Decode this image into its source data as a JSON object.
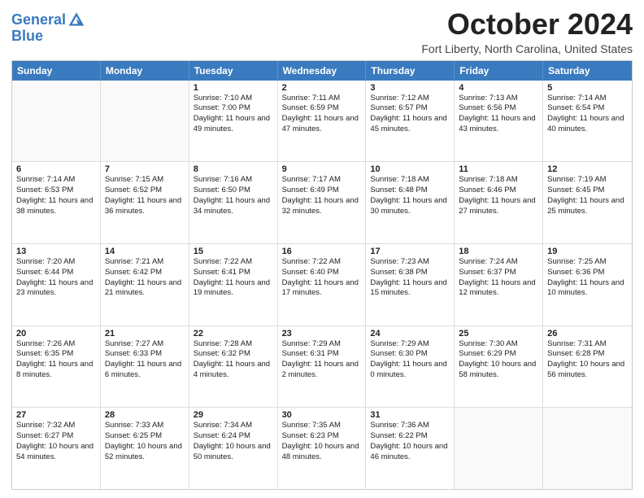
{
  "header": {
    "logo_line1": "General",
    "logo_line2": "Blue",
    "month_title": "October 2024",
    "location": "Fort Liberty, North Carolina, United States"
  },
  "weekdays": [
    "Sunday",
    "Monday",
    "Tuesday",
    "Wednesday",
    "Thursday",
    "Friday",
    "Saturday"
  ],
  "rows": [
    [
      {
        "day": "",
        "sunrise": "",
        "sunset": "",
        "daylight": "",
        "empty": true
      },
      {
        "day": "",
        "sunrise": "",
        "sunset": "",
        "daylight": "",
        "empty": true
      },
      {
        "day": "1",
        "sunrise": "Sunrise: 7:10 AM",
        "sunset": "Sunset: 7:00 PM",
        "daylight": "Daylight: 11 hours and 49 minutes."
      },
      {
        "day": "2",
        "sunrise": "Sunrise: 7:11 AM",
        "sunset": "Sunset: 6:59 PM",
        "daylight": "Daylight: 11 hours and 47 minutes."
      },
      {
        "day": "3",
        "sunrise": "Sunrise: 7:12 AM",
        "sunset": "Sunset: 6:57 PM",
        "daylight": "Daylight: 11 hours and 45 minutes."
      },
      {
        "day": "4",
        "sunrise": "Sunrise: 7:13 AM",
        "sunset": "Sunset: 6:56 PM",
        "daylight": "Daylight: 11 hours and 43 minutes."
      },
      {
        "day": "5",
        "sunrise": "Sunrise: 7:14 AM",
        "sunset": "Sunset: 6:54 PM",
        "daylight": "Daylight: 11 hours and 40 minutes."
      }
    ],
    [
      {
        "day": "6",
        "sunrise": "Sunrise: 7:14 AM",
        "sunset": "Sunset: 6:53 PM",
        "daylight": "Daylight: 11 hours and 38 minutes."
      },
      {
        "day": "7",
        "sunrise": "Sunrise: 7:15 AM",
        "sunset": "Sunset: 6:52 PM",
        "daylight": "Daylight: 11 hours and 36 minutes."
      },
      {
        "day": "8",
        "sunrise": "Sunrise: 7:16 AM",
        "sunset": "Sunset: 6:50 PM",
        "daylight": "Daylight: 11 hours and 34 minutes."
      },
      {
        "day": "9",
        "sunrise": "Sunrise: 7:17 AM",
        "sunset": "Sunset: 6:49 PM",
        "daylight": "Daylight: 11 hours and 32 minutes."
      },
      {
        "day": "10",
        "sunrise": "Sunrise: 7:18 AM",
        "sunset": "Sunset: 6:48 PM",
        "daylight": "Daylight: 11 hours and 30 minutes."
      },
      {
        "day": "11",
        "sunrise": "Sunrise: 7:18 AM",
        "sunset": "Sunset: 6:46 PM",
        "daylight": "Daylight: 11 hours and 27 minutes."
      },
      {
        "day": "12",
        "sunrise": "Sunrise: 7:19 AM",
        "sunset": "Sunset: 6:45 PM",
        "daylight": "Daylight: 11 hours and 25 minutes."
      }
    ],
    [
      {
        "day": "13",
        "sunrise": "Sunrise: 7:20 AM",
        "sunset": "Sunset: 6:44 PM",
        "daylight": "Daylight: 11 hours and 23 minutes."
      },
      {
        "day": "14",
        "sunrise": "Sunrise: 7:21 AM",
        "sunset": "Sunset: 6:42 PM",
        "daylight": "Daylight: 11 hours and 21 minutes."
      },
      {
        "day": "15",
        "sunrise": "Sunrise: 7:22 AM",
        "sunset": "Sunset: 6:41 PM",
        "daylight": "Daylight: 11 hours and 19 minutes."
      },
      {
        "day": "16",
        "sunrise": "Sunrise: 7:22 AM",
        "sunset": "Sunset: 6:40 PM",
        "daylight": "Daylight: 11 hours and 17 minutes."
      },
      {
        "day": "17",
        "sunrise": "Sunrise: 7:23 AM",
        "sunset": "Sunset: 6:38 PM",
        "daylight": "Daylight: 11 hours and 15 minutes."
      },
      {
        "day": "18",
        "sunrise": "Sunrise: 7:24 AM",
        "sunset": "Sunset: 6:37 PM",
        "daylight": "Daylight: 11 hours and 12 minutes."
      },
      {
        "day": "19",
        "sunrise": "Sunrise: 7:25 AM",
        "sunset": "Sunset: 6:36 PM",
        "daylight": "Daylight: 11 hours and 10 minutes."
      }
    ],
    [
      {
        "day": "20",
        "sunrise": "Sunrise: 7:26 AM",
        "sunset": "Sunset: 6:35 PM",
        "daylight": "Daylight: 11 hours and 8 minutes."
      },
      {
        "day": "21",
        "sunrise": "Sunrise: 7:27 AM",
        "sunset": "Sunset: 6:33 PM",
        "daylight": "Daylight: 11 hours and 6 minutes."
      },
      {
        "day": "22",
        "sunrise": "Sunrise: 7:28 AM",
        "sunset": "Sunset: 6:32 PM",
        "daylight": "Daylight: 11 hours and 4 minutes."
      },
      {
        "day": "23",
        "sunrise": "Sunrise: 7:29 AM",
        "sunset": "Sunset: 6:31 PM",
        "daylight": "Daylight: 11 hours and 2 minutes."
      },
      {
        "day": "24",
        "sunrise": "Sunrise: 7:29 AM",
        "sunset": "Sunset: 6:30 PM",
        "daylight": "Daylight: 11 hours and 0 minutes."
      },
      {
        "day": "25",
        "sunrise": "Sunrise: 7:30 AM",
        "sunset": "Sunset: 6:29 PM",
        "daylight": "Daylight: 10 hours and 58 minutes."
      },
      {
        "day": "26",
        "sunrise": "Sunrise: 7:31 AM",
        "sunset": "Sunset: 6:28 PM",
        "daylight": "Daylight: 10 hours and 56 minutes."
      }
    ],
    [
      {
        "day": "27",
        "sunrise": "Sunrise: 7:32 AM",
        "sunset": "Sunset: 6:27 PM",
        "daylight": "Daylight: 10 hours and 54 minutes."
      },
      {
        "day": "28",
        "sunrise": "Sunrise: 7:33 AM",
        "sunset": "Sunset: 6:25 PM",
        "daylight": "Daylight: 10 hours and 52 minutes."
      },
      {
        "day": "29",
        "sunrise": "Sunrise: 7:34 AM",
        "sunset": "Sunset: 6:24 PM",
        "daylight": "Daylight: 10 hours and 50 minutes."
      },
      {
        "day": "30",
        "sunrise": "Sunrise: 7:35 AM",
        "sunset": "Sunset: 6:23 PM",
        "daylight": "Daylight: 10 hours and 48 minutes."
      },
      {
        "day": "31",
        "sunrise": "Sunrise: 7:36 AM",
        "sunset": "Sunset: 6:22 PM",
        "daylight": "Daylight: 10 hours and 46 minutes."
      },
      {
        "day": "",
        "sunrise": "",
        "sunset": "",
        "daylight": "",
        "empty": true
      },
      {
        "day": "",
        "sunrise": "",
        "sunset": "",
        "daylight": "",
        "empty": true
      }
    ]
  ]
}
